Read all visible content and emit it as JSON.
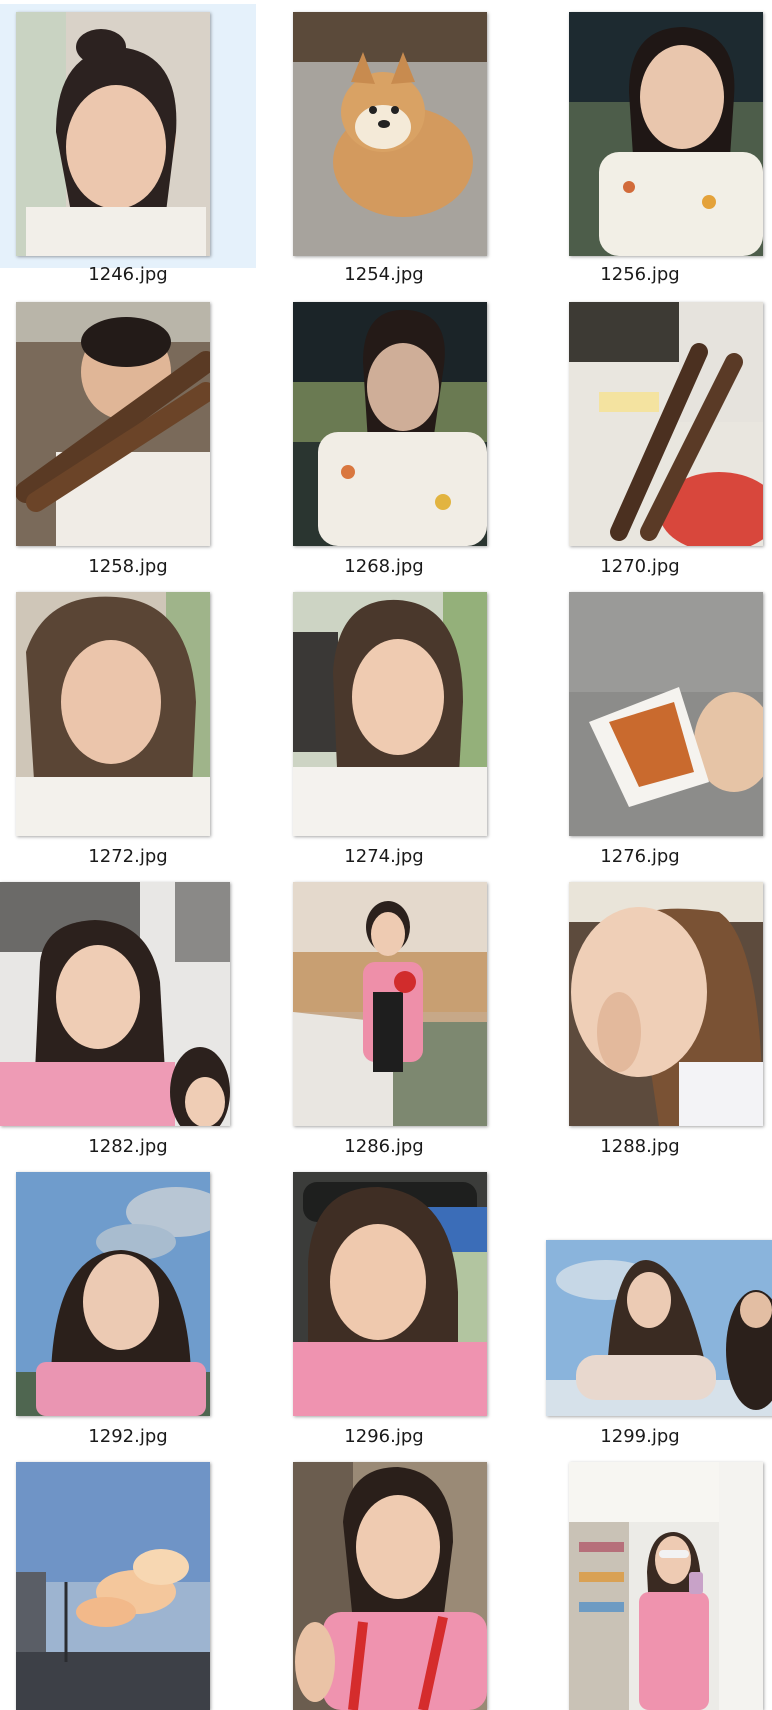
{
  "files": [
    {
      "name": "1246.jpg",
      "selected": true,
      "subject": "selfie-bun-hair"
    },
    {
      "name": "1254.jpg",
      "selected": false,
      "subject": "akita-dog"
    },
    {
      "name": "1256.jpg",
      "selected": false,
      "subject": "selfie-night-street"
    },
    {
      "name": "1258.jpg",
      "selected": false,
      "subject": "kid-with-skewers"
    },
    {
      "name": "1268.jpg",
      "selected": false,
      "subject": "selfie-night-blurred"
    },
    {
      "name": "1270.jpg",
      "selected": false,
      "subject": "skewers-and-watermelon"
    },
    {
      "name": "1272.jpg",
      "selected": false,
      "subject": "selfie-car-window"
    },
    {
      "name": "1274.jpg",
      "selected": false,
      "subject": "selfie-car-seat"
    },
    {
      "name": "1276.jpg",
      "selected": false,
      "subject": "pastry-in-paper-cup"
    },
    {
      "name": "1282.jpg",
      "selected": false,
      "subject": "selfie-pout-pink-shirt"
    },
    {
      "name": "1286.jpg",
      "selected": false,
      "subject": "girl-at-restaurant-table"
    },
    {
      "name": "1288.jpg",
      "selected": false,
      "subject": "closeup-cap-selfie"
    },
    {
      "name": "1292.jpg",
      "selected": false,
      "subject": "selfie-blue-sky"
    },
    {
      "name": "1296.jpg",
      "selected": false,
      "subject": "selfie-in-bus"
    },
    {
      "name": "1299.jpg",
      "selected": false,
      "subject": "selfie-sky-windy-hair"
    },
    {
      "name": "",
      "selected": false,
      "subject": "sunset-clouds-street"
    },
    {
      "name": "",
      "selected": false,
      "subject": "selfie-red-apron"
    },
    {
      "name": "",
      "selected": false,
      "subject": "mirror-selfie-store"
    }
  ],
  "colors": {
    "selection": "#e5f1fb",
    "label": "#1a1a1a"
  }
}
